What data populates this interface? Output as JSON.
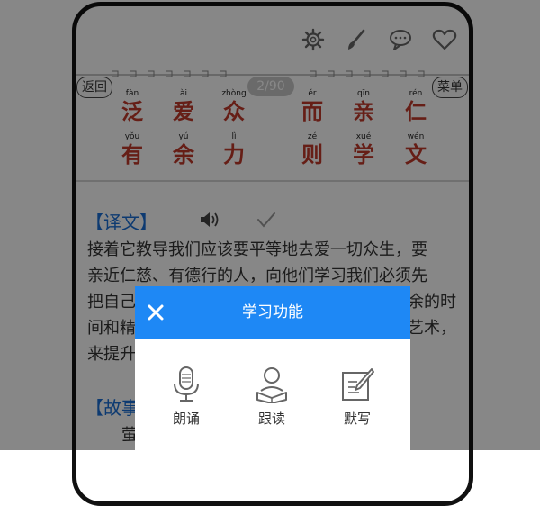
{
  "nav": {
    "back_label": "返回",
    "menu_label": "菜单",
    "counter": "2/90"
  },
  "toolbar": {
    "icons": [
      "gear-icon",
      "brush-icon",
      "comment-icon",
      "heart-icon"
    ]
  },
  "verse": {
    "line1": [
      {
        "pinyin": "fàn",
        "char": "泛"
      },
      {
        "pinyin": "ài",
        "char": "爱"
      },
      {
        "pinyin": "zhòng",
        "char": "众"
      },
      {
        "pinyin": "ér",
        "char": "而"
      },
      {
        "pinyin": "qīn",
        "char": "亲"
      },
      {
        "pinyin": "rén",
        "char": "仁"
      }
    ],
    "line2": [
      {
        "pinyin": "yǒu",
        "char": "有"
      },
      {
        "pinyin": "yú",
        "char": "余"
      },
      {
        "pinyin": "lì",
        "char": "力"
      },
      {
        "pinyin": "zé",
        "char": "则"
      },
      {
        "pinyin": "xué",
        "char": "学"
      },
      {
        "pinyin": "wén",
        "char": "文"
      }
    ]
  },
  "translation": {
    "title": "【译文】",
    "lines": [
      "接着它教导我们应该要平等地去爱一切众生，要",
      "亲近仁慈、有德行的人，向他们学习我们必须先",
      "把自己",
      "余的时",
      "间和精",
      "艺术，",
      "来提升"
    ]
  },
  "story": {
    "title_partial": "【故事",
    "line_partial": "萤"
  },
  "modal": {
    "title": "学习功能",
    "functions": [
      {
        "label": "朗诵",
        "icon": "microphone-icon"
      },
      {
        "label": "跟读",
        "icon": "reader-icon"
      },
      {
        "label": "默写",
        "icon": "dictation-icon"
      }
    ]
  },
  "colors": {
    "accent": "#1e88f5",
    "hanzi": "#c0392b",
    "section_title": "#1a6fd6"
  }
}
